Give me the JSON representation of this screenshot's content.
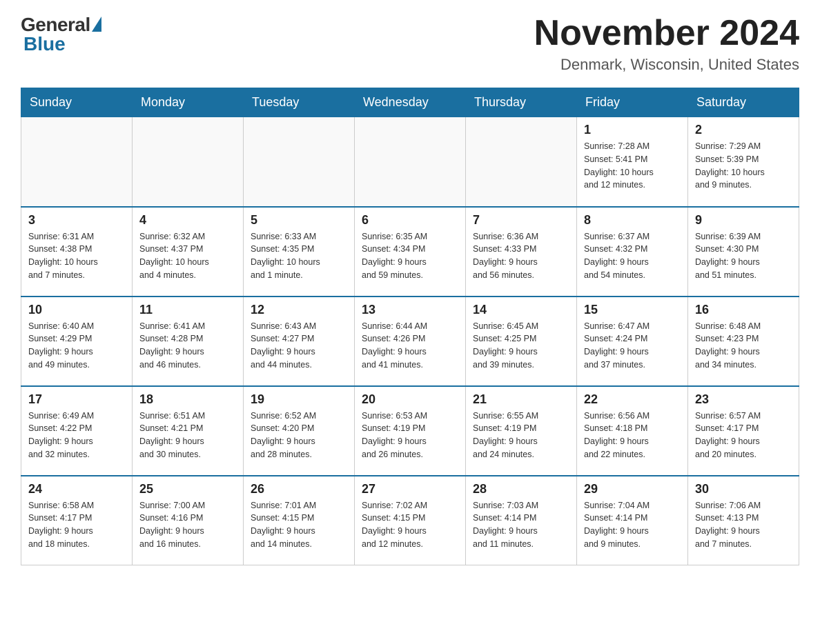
{
  "logo": {
    "general": "General",
    "blue": "Blue"
  },
  "title": "November 2024",
  "location": "Denmark, Wisconsin, United States",
  "days_of_week": [
    "Sunday",
    "Monday",
    "Tuesday",
    "Wednesday",
    "Thursday",
    "Friday",
    "Saturday"
  ],
  "weeks": [
    [
      {
        "day": "",
        "info": ""
      },
      {
        "day": "",
        "info": ""
      },
      {
        "day": "",
        "info": ""
      },
      {
        "day": "",
        "info": ""
      },
      {
        "day": "",
        "info": ""
      },
      {
        "day": "1",
        "info": "Sunrise: 7:28 AM\nSunset: 5:41 PM\nDaylight: 10 hours\nand 12 minutes."
      },
      {
        "day": "2",
        "info": "Sunrise: 7:29 AM\nSunset: 5:39 PM\nDaylight: 10 hours\nand 9 minutes."
      }
    ],
    [
      {
        "day": "3",
        "info": "Sunrise: 6:31 AM\nSunset: 4:38 PM\nDaylight: 10 hours\nand 7 minutes."
      },
      {
        "day": "4",
        "info": "Sunrise: 6:32 AM\nSunset: 4:37 PM\nDaylight: 10 hours\nand 4 minutes."
      },
      {
        "day": "5",
        "info": "Sunrise: 6:33 AM\nSunset: 4:35 PM\nDaylight: 10 hours\nand 1 minute."
      },
      {
        "day": "6",
        "info": "Sunrise: 6:35 AM\nSunset: 4:34 PM\nDaylight: 9 hours\nand 59 minutes."
      },
      {
        "day": "7",
        "info": "Sunrise: 6:36 AM\nSunset: 4:33 PM\nDaylight: 9 hours\nand 56 minutes."
      },
      {
        "day": "8",
        "info": "Sunrise: 6:37 AM\nSunset: 4:32 PM\nDaylight: 9 hours\nand 54 minutes."
      },
      {
        "day": "9",
        "info": "Sunrise: 6:39 AM\nSunset: 4:30 PM\nDaylight: 9 hours\nand 51 minutes."
      }
    ],
    [
      {
        "day": "10",
        "info": "Sunrise: 6:40 AM\nSunset: 4:29 PM\nDaylight: 9 hours\nand 49 minutes."
      },
      {
        "day": "11",
        "info": "Sunrise: 6:41 AM\nSunset: 4:28 PM\nDaylight: 9 hours\nand 46 minutes."
      },
      {
        "day": "12",
        "info": "Sunrise: 6:43 AM\nSunset: 4:27 PM\nDaylight: 9 hours\nand 44 minutes."
      },
      {
        "day": "13",
        "info": "Sunrise: 6:44 AM\nSunset: 4:26 PM\nDaylight: 9 hours\nand 41 minutes."
      },
      {
        "day": "14",
        "info": "Sunrise: 6:45 AM\nSunset: 4:25 PM\nDaylight: 9 hours\nand 39 minutes."
      },
      {
        "day": "15",
        "info": "Sunrise: 6:47 AM\nSunset: 4:24 PM\nDaylight: 9 hours\nand 37 minutes."
      },
      {
        "day": "16",
        "info": "Sunrise: 6:48 AM\nSunset: 4:23 PM\nDaylight: 9 hours\nand 34 minutes."
      }
    ],
    [
      {
        "day": "17",
        "info": "Sunrise: 6:49 AM\nSunset: 4:22 PM\nDaylight: 9 hours\nand 32 minutes."
      },
      {
        "day": "18",
        "info": "Sunrise: 6:51 AM\nSunset: 4:21 PM\nDaylight: 9 hours\nand 30 minutes."
      },
      {
        "day": "19",
        "info": "Sunrise: 6:52 AM\nSunset: 4:20 PM\nDaylight: 9 hours\nand 28 minutes."
      },
      {
        "day": "20",
        "info": "Sunrise: 6:53 AM\nSunset: 4:19 PM\nDaylight: 9 hours\nand 26 minutes."
      },
      {
        "day": "21",
        "info": "Sunrise: 6:55 AM\nSunset: 4:19 PM\nDaylight: 9 hours\nand 24 minutes."
      },
      {
        "day": "22",
        "info": "Sunrise: 6:56 AM\nSunset: 4:18 PM\nDaylight: 9 hours\nand 22 minutes."
      },
      {
        "day": "23",
        "info": "Sunrise: 6:57 AM\nSunset: 4:17 PM\nDaylight: 9 hours\nand 20 minutes."
      }
    ],
    [
      {
        "day": "24",
        "info": "Sunrise: 6:58 AM\nSunset: 4:17 PM\nDaylight: 9 hours\nand 18 minutes."
      },
      {
        "day": "25",
        "info": "Sunrise: 7:00 AM\nSunset: 4:16 PM\nDaylight: 9 hours\nand 16 minutes."
      },
      {
        "day": "26",
        "info": "Sunrise: 7:01 AM\nSunset: 4:15 PM\nDaylight: 9 hours\nand 14 minutes."
      },
      {
        "day": "27",
        "info": "Sunrise: 7:02 AM\nSunset: 4:15 PM\nDaylight: 9 hours\nand 12 minutes."
      },
      {
        "day": "28",
        "info": "Sunrise: 7:03 AM\nSunset: 4:14 PM\nDaylight: 9 hours\nand 11 minutes."
      },
      {
        "day": "29",
        "info": "Sunrise: 7:04 AM\nSunset: 4:14 PM\nDaylight: 9 hours\nand 9 minutes."
      },
      {
        "day": "30",
        "info": "Sunrise: 7:06 AM\nSunset: 4:13 PM\nDaylight: 9 hours\nand 7 minutes."
      }
    ]
  ]
}
